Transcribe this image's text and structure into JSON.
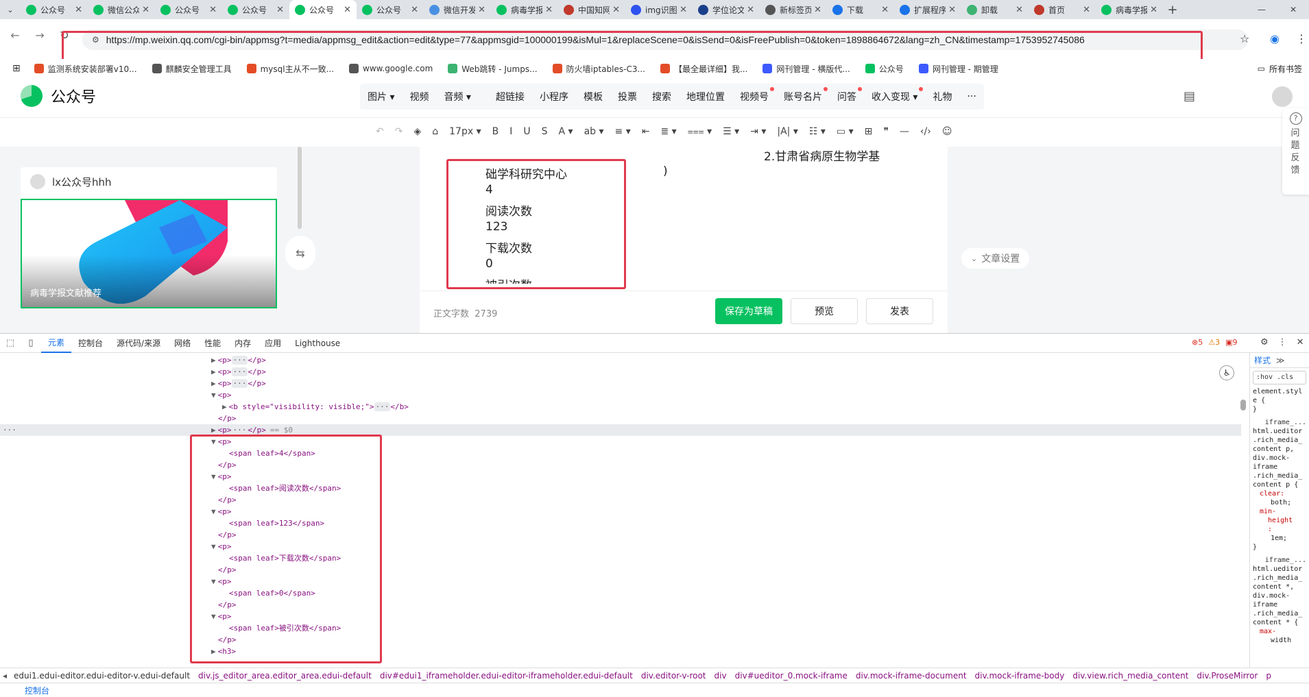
{
  "browser": {
    "tabs": [
      {
        "label": "公众号",
        "color": "#07c160",
        "active": false
      },
      {
        "label": "微信公众平台",
        "color": "#07c160",
        "active": false
      },
      {
        "label": "公众号",
        "color": "#07c160",
        "active": false
      },
      {
        "label": "公众号",
        "color": "#07c160",
        "active": false
      },
      {
        "label": "公众号",
        "color": "#07c160",
        "active": true
      },
      {
        "label": "公众号",
        "color": "#07c160",
        "active": false
      },
      {
        "label": "微信开发者",
        "color": "#4a90e2",
        "active": false
      },
      {
        "label": "病毒学报",
        "color": "#07c160",
        "active": false
      },
      {
        "label": "中国知网",
        "color": "#c0392b",
        "active": false
      },
      {
        "label": "img识图",
        "color": "#2d52f0",
        "active": false
      },
      {
        "label": "学位论文",
        "color": "#1a3f8a",
        "active": false
      },
      {
        "label": "新标签页",
        "color": "#555555",
        "active": false
      },
      {
        "label": "下载",
        "color": "#1a73e8",
        "active": false
      },
      {
        "label": "扩展程序",
        "color": "#1a73e8",
        "active": false
      },
      {
        "label": "卸载",
        "color": "#3cb371",
        "active": false
      },
      {
        "label": "首页",
        "color": "#c0392b",
        "active": false
      },
      {
        "label": "病毒学报",
        "color": "#07c160",
        "active": false
      }
    ],
    "url": "https://mp.weixin.qq.com/cgi-bin/appmsg?t=media/appmsg_edit&action=edit&type=77&appmsgid=100000199&isMul=1&replaceScene=0&isSend=0&isFreePublish=0&token=1898864672&lang=zh_CN&timestamp=1753952745086",
    "bookmarks": [
      {
        "label": "监测系统安装部署v10...",
        "color": "#e34c26"
      },
      {
        "label": "麒麟安全管理工具",
        "color": "#555555"
      },
      {
        "label": "mysql主从不一致...",
        "color": "#e34c26"
      },
      {
        "label": "www.google.com",
        "color": "#555555"
      },
      {
        "label": "Web跳转 - Jumps...",
        "color": "#3cb371"
      },
      {
        "label": "防火墙iptables-C3...",
        "color": "#e34c26"
      },
      {
        "label": "【最全最详细】我...",
        "color": "#e34c26"
      },
      {
        "label": "网刊管理 - 横版代...",
        "color": "#3d5afe"
      },
      {
        "label": "公众号",
        "color": "#07c160"
      },
      {
        "label": "网刊管理 - 期管理",
        "color": "#3d5afe"
      }
    ],
    "all_bookmarks": "所有书签"
  },
  "editor": {
    "brand": "公众号",
    "insert_items": [
      {
        "label": "图片 ▾",
        "dot": false,
        "gap": false
      },
      {
        "label": "视频",
        "dot": false,
        "gap": false
      },
      {
        "label": "音频 ▾",
        "dot": false,
        "gap": false
      },
      {
        "label": "超链接",
        "dot": false,
        "gap": true
      },
      {
        "label": "小程序",
        "dot": false,
        "gap": false
      },
      {
        "label": "模板",
        "dot": false,
        "gap": false
      },
      {
        "label": "投票",
        "dot": false,
        "gap": false
      },
      {
        "label": "搜索",
        "dot": false,
        "gap": false
      },
      {
        "label": "地理位置",
        "dot": false,
        "gap": false
      },
      {
        "label": "视频号",
        "dot": true,
        "gap": false
      },
      {
        "label": "账号名片",
        "dot": true,
        "gap": false
      },
      {
        "label": "问答",
        "dot": true,
        "gap": false
      },
      {
        "label": "收入变现 ▾",
        "dot": true,
        "gap": false
      },
      {
        "label": "礼物",
        "dot": false,
        "gap": false
      },
      {
        "label": "···",
        "dot": false,
        "gap": false
      }
    ],
    "format_tools": [
      "↶",
      "↷",
      "◈",
      "⌂",
      "17px ▾",
      "B",
      "I",
      "U",
      "S",
      "A ▾",
      "ab ▾",
      "≡ ▾",
      "⇤",
      "≣ ▾",
      "⩶ ▾",
      "☰ ▾",
      "⇥ ▾",
      "|A| ▾",
      "☷ ▾",
      "▭ ▾",
      "⊞",
      "❞",
      "—",
      "‹/›",
      "☺"
    ],
    "account_name": "lx公众号hhh",
    "cover_title": "病毒学报文献推荐",
    "article_lines": [
      "2.甘肃省病原生物学基",
      "础学科研究中心",
      ")",
      "4",
      "阅读次数",
      "123",
      "下载次数",
      "0",
      "被引次数"
    ],
    "article_settings": "文章设置",
    "word_count_label": "正文字数",
    "word_count": "2739",
    "save_draft": "保存为草稿",
    "preview": "预览",
    "publish": "发表",
    "feedback": "问题反馈"
  },
  "devtools": {
    "tabs": [
      "元素",
      "控制台",
      "源代码/来源",
      "网络",
      "性能",
      "内存",
      "应用",
      "Lighthouse"
    ],
    "errors": "5",
    "warnings": "3",
    "issues": "9",
    "dom_lines": [
      {
        "indent": 0,
        "arrow": "▶",
        "html": "<p>",
        "ellipsis": true,
        "close": "</p>",
        "eq": ""
      },
      {
        "indent": 0,
        "arrow": "▶",
        "html": "<p>",
        "ellipsis": true,
        "close": "</p>",
        "eq": ""
      },
      {
        "indent": 0,
        "arrow": "▶",
        "html": "<p>",
        "ellipsis": true,
        "close": "</p>",
        "eq": ""
      },
      {
        "indent": 0,
        "arrow": "▼",
        "html": "<p>",
        "ellipsis": false,
        "close": "",
        "eq": ""
      },
      {
        "indent": 1,
        "arrow": "▶",
        "html": "<b style=\"visibility: visible;\">",
        "ellipsis": true,
        "close": "</b>",
        "eq": ""
      },
      {
        "indent": 0,
        "arrow": "",
        "html": "</p>",
        "ellipsis": false,
        "close": "",
        "eq": ""
      },
      {
        "indent": 0,
        "arrow": "▶",
        "html": "<p>",
        "ellipsis": true,
        "close": "</p>",
        "eq": "== $0"
      },
      {
        "indent": 0,
        "arrow": "▼",
        "html": "<p>",
        "ellipsis": false,
        "close": "",
        "eq": ""
      },
      {
        "indent": 1,
        "arrow": "",
        "html": "<span leaf>4</span>",
        "ellipsis": false,
        "close": "",
        "eq": ""
      },
      {
        "indent": 0,
        "arrow": "",
        "html": "</p>",
        "ellipsis": false,
        "close": "",
        "eq": ""
      },
      {
        "indent": 0,
        "arrow": "▼",
        "html": "<p>",
        "ellipsis": false,
        "close": "",
        "eq": ""
      },
      {
        "indent": 1,
        "arrow": "",
        "html": "<span leaf>阅读次数</span>",
        "ellipsis": false,
        "close": "",
        "eq": ""
      },
      {
        "indent": 0,
        "arrow": "",
        "html": "</p>",
        "ellipsis": false,
        "close": "",
        "eq": ""
      },
      {
        "indent": 0,
        "arrow": "▼",
        "html": "<p>",
        "ellipsis": false,
        "close": "",
        "eq": ""
      },
      {
        "indent": 1,
        "arrow": "",
        "html": "<span leaf>123</span>",
        "ellipsis": false,
        "close": "",
        "eq": ""
      },
      {
        "indent": 0,
        "arrow": "",
        "html": "</p>",
        "ellipsis": false,
        "close": "",
        "eq": ""
      },
      {
        "indent": 0,
        "arrow": "▼",
        "html": "<p>",
        "ellipsis": false,
        "close": "",
        "eq": ""
      },
      {
        "indent": 1,
        "arrow": "",
        "html": "<span leaf>下载次数</span>",
        "ellipsis": false,
        "close": "",
        "eq": ""
      },
      {
        "indent": 0,
        "arrow": "",
        "html": "</p>",
        "ellipsis": false,
        "close": "",
        "eq": ""
      },
      {
        "indent": 0,
        "arrow": "▼",
        "html": "<p>",
        "ellipsis": false,
        "close": "",
        "eq": ""
      },
      {
        "indent": 1,
        "arrow": "",
        "html": "<span leaf>0</span>",
        "ellipsis": false,
        "close": "",
        "eq": ""
      },
      {
        "indent": 0,
        "arrow": "",
        "html": "</p>",
        "ellipsis": false,
        "close": "",
        "eq": ""
      },
      {
        "indent": 0,
        "arrow": "▼",
        "html": "<p>",
        "ellipsis": false,
        "close": "",
        "eq": ""
      },
      {
        "indent": 1,
        "arrow": "",
        "html": "<span leaf>被引次数</span>",
        "ellipsis": false,
        "close": "",
        "eq": ""
      },
      {
        "indent": 0,
        "arrow": "",
        "html": "</p>",
        "ellipsis": false,
        "close": "",
        "eq": ""
      },
      {
        "indent": 0,
        "arrow": "▶",
        "html": "<h3>",
        "ellipsis": false,
        "close": "",
        "eq": ""
      }
    ],
    "styles_tab": "样式",
    "styles_filter": ":hov .cls",
    "styles_lines": [
      {
        "k": "sel",
        "t": "element.styl"
      },
      {
        "k": "sel",
        "t": "e {"
      },
      {
        "k": "sel",
        "t": "}"
      },
      {
        "k": "hdr",
        "t": "iframe_..."
      },
      {
        "k": "sel",
        "t": "html.ueditor"
      },
      {
        "k": "sel",
        "t": ".rich_media_"
      },
      {
        "k": "sel",
        "t": "content p,"
      },
      {
        "k": "sel",
        "t": "div.mock-"
      },
      {
        "k": "sel",
        "t": "iframe"
      },
      {
        "k": "sel",
        "t": ".rich_media_"
      },
      {
        "k": "sel",
        "t": "content p {"
      },
      {
        "k": "prop",
        "t": "clear:"
      },
      {
        "k": "v",
        "t": "both;"
      },
      {
        "k": "prop",
        "t": "min-"
      },
      {
        "k": "prop",
        "t": "  height"
      },
      {
        "k": "prop",
        "t": "  :"
      },
      {
        "k": "v",
        "t": "1em;"
      },
      {
        "k": "sel",
        "t": "}"
      },
      {
        "k": "hdr",
        "t": "iframe_..."
      },
      {
        "k": "sel",
        "t": "html.ueditor"
      },
      {
        "k": "sel",
        "t": ".rich_media_"
      },
      {
        "k": "sel",
        "t": "content *,"
      },
      {
        "k": "sel",
        "t": "div.mock-"
      },
      {
        "k": "sel",
        "t": "iframe"
      },
      {
        "k": "sel",
        "t": ".rich_media_"
      },
      {
        "k": "sel",
        "t": "content * {"
      },
      {
        "k": "prop",
        "t": "max-"
      },
      {
        "k": "v",
        "t": "width"
      }
    ],
    "breadcrumbs": [
      "edui1.edui-editor.edui-editor-v.edui-default",
      "div.js_editor_area.editor_area.edui-default",
      "div#edui1_iframeholder.edui-editor-iframeholder.edui-default",
      "div.editor-v-root",
      "div",
      "div#ueditor_0.mock-iframe",
      "div.mock-iframe-document",
      "div.mock-iframe-body",
      "div.view.rich_media_content",
      "div.ProseMirror",
      "p"
    ],
    "console_drawer": "控制台"
  }
}
